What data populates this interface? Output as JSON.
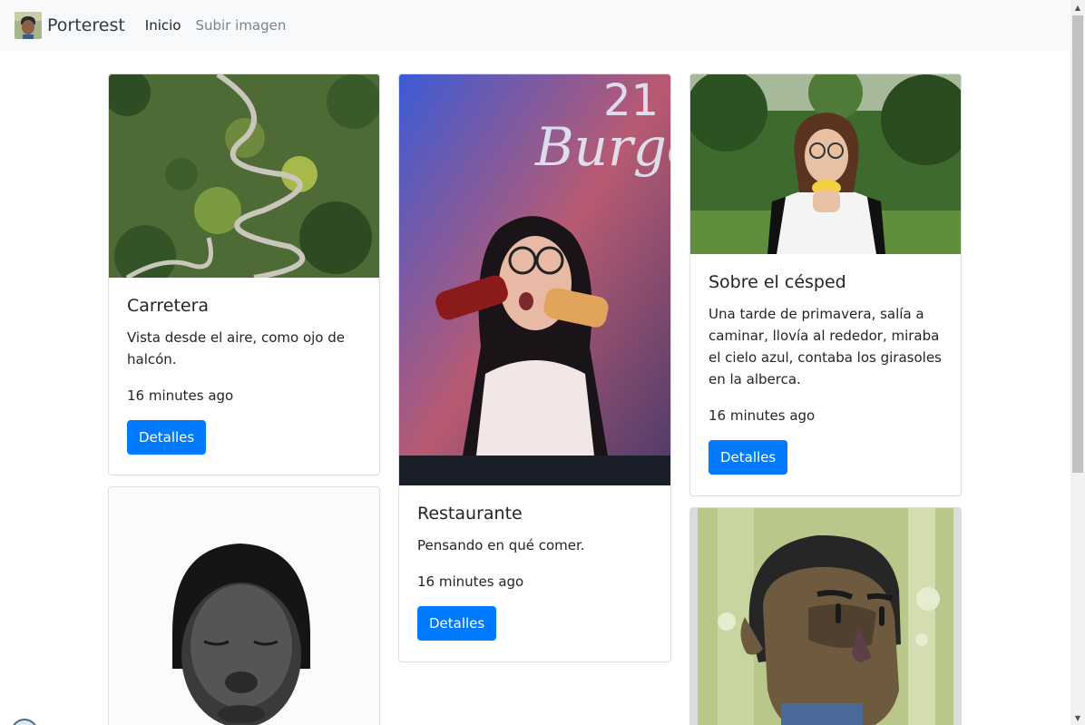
{
  "navbar": {
    "brand": "Porterest",
    "links": [
      {
        "label": "Inicio",
        "active": true
      },
      {
        "label": "Subir imagen",
        "active": false
      }
    ]
  },
  "cards": [
    {
      "title": "Carretera",
      "text": "Vista desde el aire, como ojo de halcón.",
      "time": "16 minutes ago",
      "button": "Detalles",
      "image": "aerial-road-photo"
    },
    {
      "title": "Restaurante",
      "text": "Pensando en qué comer.",
      "time": "16 minutes ago",
      "button": "Detalles",
      "image": "woman-with-sauce-bottles-photo"
    },
    {
      "title": "Sobre el césped",
      "text": "Una tarde de primavera, salía a caminar, llovía al rededor, miraba el cielo azul, contaba los girasoles en la alberca.",
      "time": "16 minutes ago",
      "button": "Detalles",
      "image": "woman-holding-flower-photo"
    },
    {
      "image": "bw-portrait-photo"
    },
    {
      "image": "illustrated-man-portrait"
    }
  ],
  "colors": {
    "primary": "#007bff",
    "navbar_bg": "#f8f9fa"
  }
}
